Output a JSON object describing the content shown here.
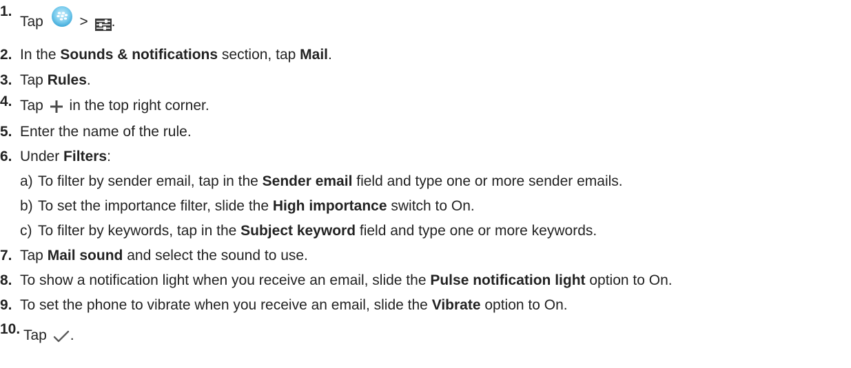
{
  "steps": [
    {
      "number": "1.",
      "parts": {
        "a": "Tap",
        "b": ">",
        "c": "."
      },
      "icons": [
        "blackberry-app-icon",
        "settings-sliders-icon"
      ]
    },
    {
      "number": "2.",
      "parts": {
        "a": "In the ",
        "b": "Sounds & notifications",
        "c": " section, tap ",
        "d": "Mail",
        "e": "."
      }
    },
    {
      "number": "3.",
      "parts": {
        "a": "Tap ",
        "b": "Rules",
        "c": "."
      }
    },
    {
      "number": "4.",
      "parts": {
        "a": "Tap",
        "b": "in the top right corner."
      },
      "icons": [
        "plus-icon"
      ]
    },
    {
      "number": "5.",
      "parts": {
        "a": "Enter the name of the rule."
      }
    },
    {
      "number": "6.",
      "parts": {
        "a": "Under ",
        "b": "Filters",
        "c": ":"
      },
      "substeps": [
        {
          "letter": "a)",
          "a": "To filter by sender email, tap in the ",
          "b": "Sender email",
          "c": " field and type one or more sender emails."
        },
        {
          "letter": "b)",
          "a": "To set the importance filter, slide the ",
          "b": "High importance",
          "c": " switch to On."
        },
        {
          "letter": "c)",
          "a": "To filter by keywords, tap in the ",
          "b": "Subject keyword",
          "c": " field and type one or more keywords."
        }
      ]
    },
    {
      "number": "7.",
      "parts": {
        "a": "Tap ",
        "b": "Mail sound",
        "c": " and select the sound to use."
      }
    },
    {
      "number": "8.",
      "parts": {
        "a": "To show a notification light when you receive an email, slide the ",
        "b": "Pulse notification light",
        "c": " option to On."
      }
    },
    {
      "number": "9.",
      "parts": {
        "a": "To set the phone to vibrate when you receive an email, slide the ",
        "b": "Vibrate",
        "c": " option to On."
      }
    },
    {
      "number": "10.",
      "parts": {
        "a": "Tap",
        "b": "."
      },
      "icons": [
        "checkmark-icon"
      ]
    }
  ]
}
